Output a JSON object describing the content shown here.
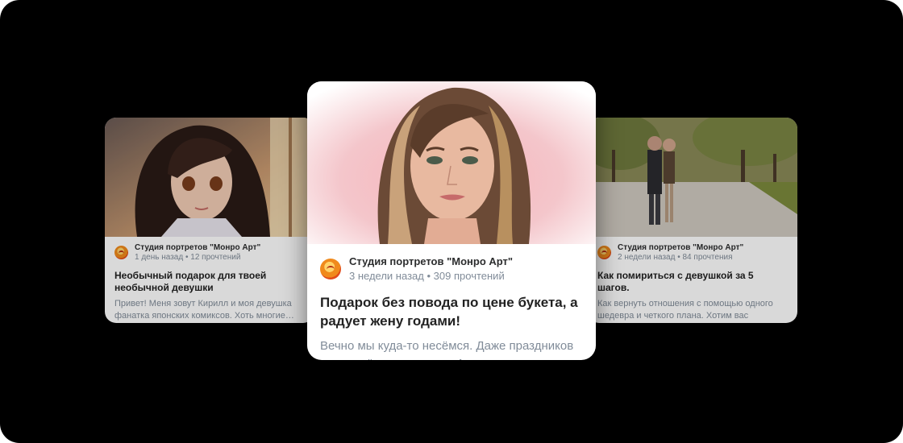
{
  "cards": [
    {
      "source": "Студия портретов \"Монро Арт\"",
      "age": "1 день назад",
      "reads": "12 прочтений",
      "title": "Необычный подарок для твоей необычной девушки",
      "desc": "Привет! Меня зовут Кирилл и моя девушка фанатка японских комиксов. Хоть многие…"
    },
    {
      "source": "Студия портретов \"Монро Арт\"",
      "age": "3 недели назад",
      "reads": "309 прочтений",
      "title": "Подарок без повода по цене букета, а радует жену годами!",
      "desc": "Вечно мы куда-то несёмся. Даже праздников и тех ждём, планируем. А он…"
    },
    {
      "source": "Студия портретов \"Монро Арт\"",
      "age": "2 недели назад",
      "reads": "84 прочтения",
      "title": "Как помириться с девушкой за 5 шагов.",
      "desc": "Как вернуть отношения с помощью одного шедевра и четкого плана. Хотим вас успокоить: нет пар, которые не ссорятся…."
    }
  ],
  "meta_separator": "•"
}
